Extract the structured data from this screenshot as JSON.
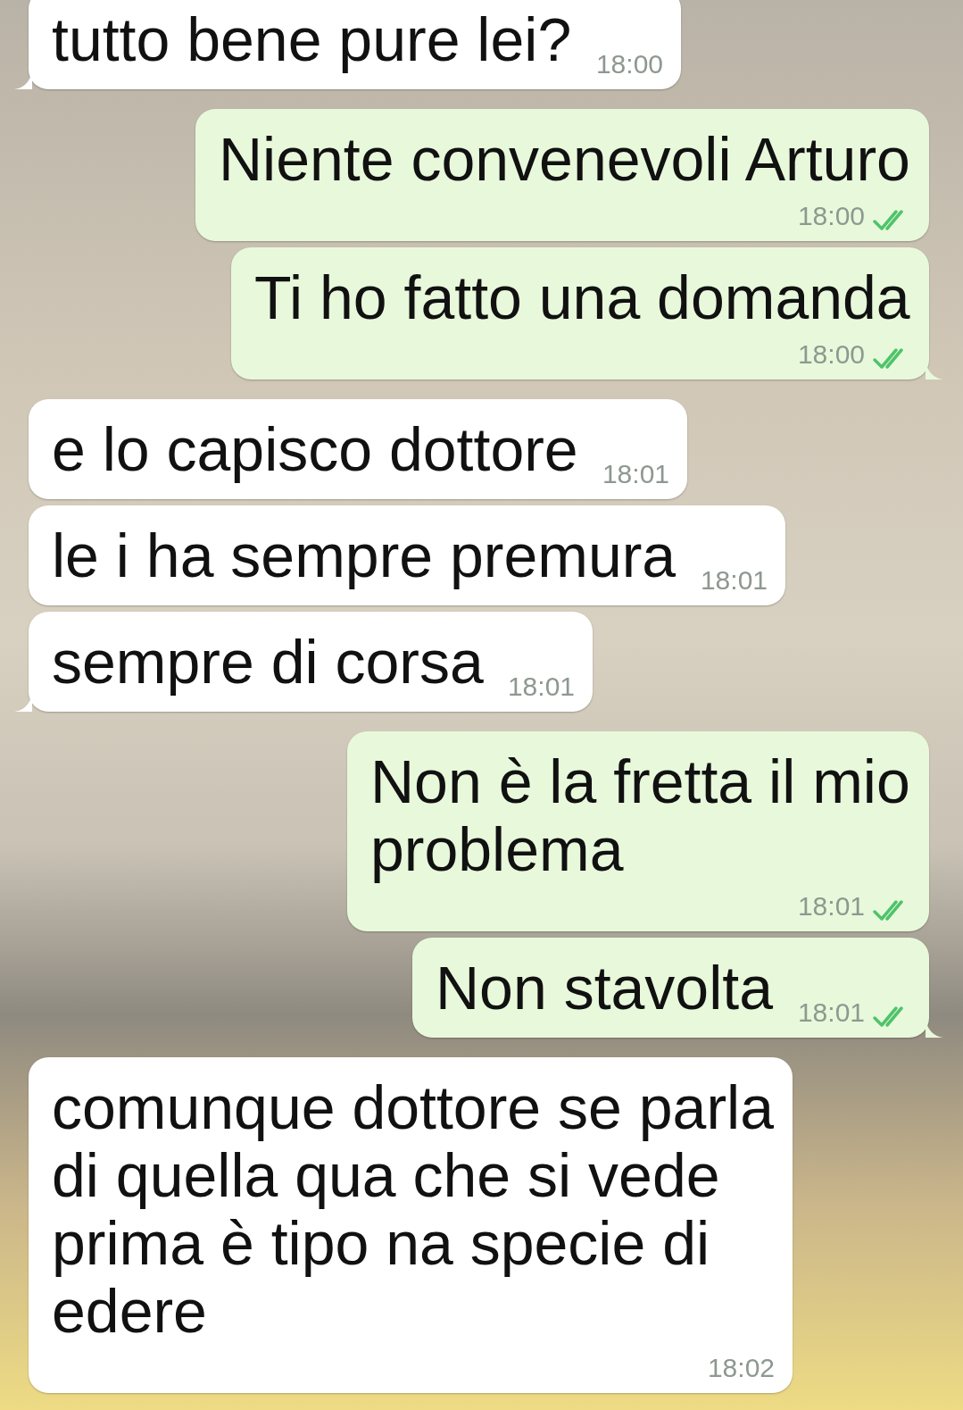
{
  "messages": [
    {
      "sent": false,
      "text": "tutto bene pure lei?",
      "time": "18:00",
      "tail": true
    },
    {
      "sent": true,
      "text": "Niente convenevoli Arturo",
      "time": "18:00",
      "tail": false,
      "read": true
    },
    {
      "sent": true,
      "text": "Ti ho fatto una domanda",
      "time": "18:00",
      "tail": true,
      "read": true
    },
    {
      "sent": false,
      "text": "e lo capisco dottore",
      "time": "18:01",
      "tail": false
    },
    {
      "sent": false,
      "text": "le i ha sempre premura",
      "time": "18:01",
      "tail": false
    },
    {
      "sent": false,
      "text": "sempre di corsa",
      "time": "18:01",
      "tail": true
    },
    {
      "sent": true,
      "text": "Non è la fretta il mio problema",
      "time": "18:01",
      "tail": false,
      "read": true
    },
    {
      "sent": true,
      "text": "Non stavolta",
      "time": "18:01",
      "tail": true,
      "read": true
    },
    {
      "sent": false,
      "text": "comunque dottore se parla di quella qua che si vede prima è tipo na specie di edere",
      "time": "18:02",
      "tail": false
    }
  ]
}
